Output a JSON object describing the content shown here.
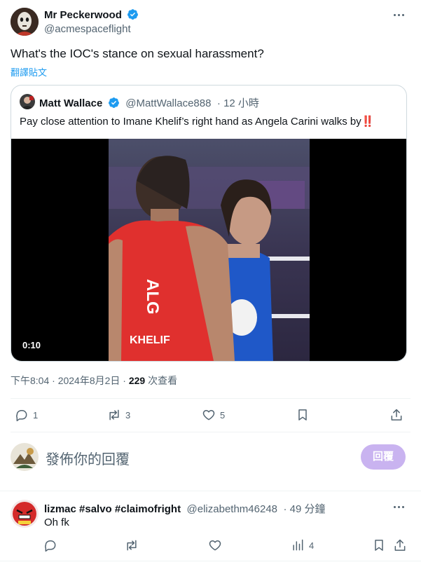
{
  "post": {
    "author_name": "Mr Peckerwood",
    "author_handle": "@acmespaceflight",
    "text": "What's the IOC's stance on sexual harassment?",
    "translate_label": "翻譯貼文",
    "timestamp": "下午8:04 · 2024年8月2日 · ",
    "views_count": "229",
    "views_label": " 次查看"
  },
  "quote": {
    "author_name": "Matt Wallace",
    "author_handle": "@MattWallace888",
    "time": "· 12 小時",
    "text": "Pay close attention to Imane Khelif’s right hand as Angela Carini walks by‼️",
    "video_duration": "0:10",
    "video_overlay_text": "KHELIF",
    "video_jersey_text": "ALG"
  },
  "actions": {
    "reply_count": "1",
    "repost_count": "3",
    "like_count": "5"
  },
  "composer": {
    "placeholder": "發佈你的回覆",
    "reply_button": "回覆"
  },
  "reply": {
    "author_name": "lizmac #salvo #claimofright",
    "author_handle": "@elizabethm46248",
    "time": "· 49 分鐘",
    "text": "Oh fk",
    "views_count": "4"
  },
  "colors": {
    "accent": "#1d9bf0",
    "reply_button_bg": "#c9b3f0",
    "text_secondary": "#536471"
  },
  "icons": {
    "verified": "verified-badge-icon",
    "reply": "speech-bubble-icon",
    "repost": "repost-arrows-icon",
    "like": "heart-icon",
    "bookmark": "bookmark-icon",
    "share": "share-upload-icon",
    "views": "bar-chart-icon",
    "more": "ellipsis-icon"
  }
}
